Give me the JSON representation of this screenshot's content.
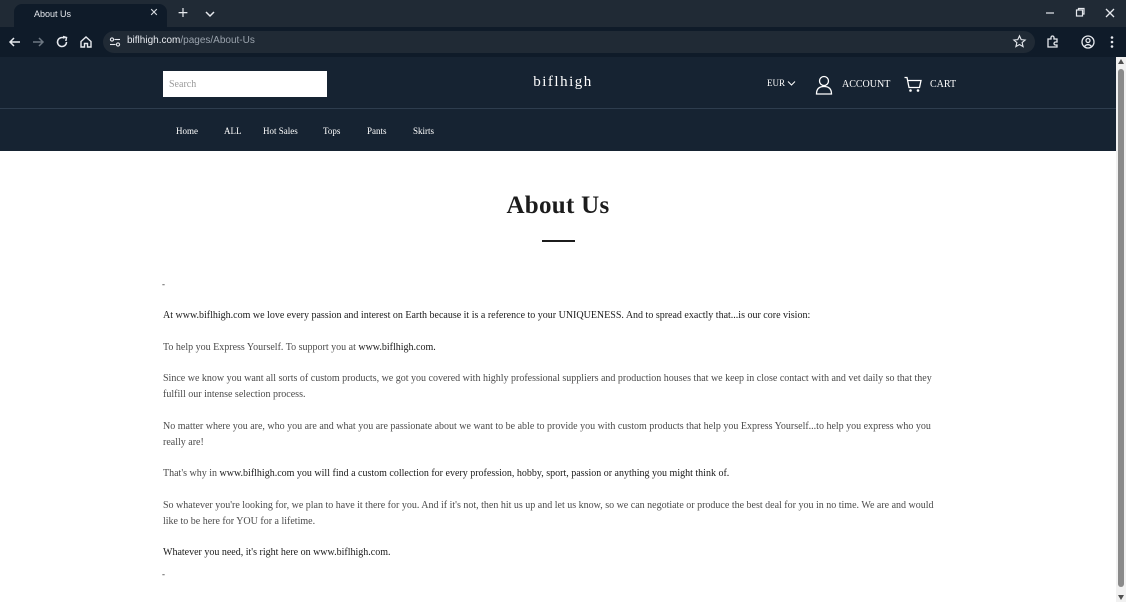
{
  "browser": {
    "tab_title": "About Us",
    "tab_close_glyph": "✕",
    "new_tab_glyph": "+",
    "url_host": "biflhigh.com",
    "url_path": "/pages/About-Us"
  },
  "header": {
    "search_placeholder": "Search",
    "logo": "biflhigh",
    "currency": "EUR",
    "account_label": "ACCOUNT",
    "cart_label": "CART"
  },
  "nav": {
    "items": [
      "Home",
      "ALL",
      "Hot Sales",
      "Tops",
      "Pants",
      "Skirts"
    ]
  },
  "page": {
    "title": "About Us",
    "dash_top": "-",
    "dash_bottom": "-",
    "p1": "At www.biflhigh.com we love every passion and interest on Earth because it is a reference to your UNIQUENESS. And to spread exactly that...is our core vision:",
    "p2_a": "To help you Express Yourself. To support you at ",
    "p2_b": "www.biflhigh.com.",
    "p3": "Since we know you want all sorts of custom products, we got you covered with highly professional suppliers and production houses that we keep in close contact with and vet daily so that they fulfill our intense selection process.",
    "p4": "No matter where you are, who you are and what you are passionate about we want to be able to provide you with custom products that help you Express Yourself...to help you express who you really are!",
    "p5_a": "That's why in ",
    "p5_b": "www.biflhigh.com you will find a custom collection for every profession, hobby, sport, passion or anything you might think of.",
    "p6": "So whatever you're looking for, we plan to have it there for you. And if it's not, then hit us up and let us know, so we can negotiate or produce the best deal for you in no time. We are and would like to be here for YOU for a lifetime.",
    "p7": "Whatever you need, it's right here on www.biflhigh.com."
  },
  "colors": {
    "chrome_dark": "#0f1b29",
    "chrome_bar": "#202a35",
    "header_bg": "#162332",
    "text_dark": "#1b1b1b",
    "text_body": "#4b4b4b"
  },
  "icons": [
    "back-icon",
    "forward-icon",
    "reload-icon",
    "home-icon",
    "site-info-icon",
    "bookmark-star-icon",
    "extensions-icon",
    "profile-icon",
    "more-menu-icon",
    "user-icon",
    "cart-icon",
    "chevron-down-icon",
    "minimize-icon",
    "restore-icon",
    "close-window-icon"
  ]
}
